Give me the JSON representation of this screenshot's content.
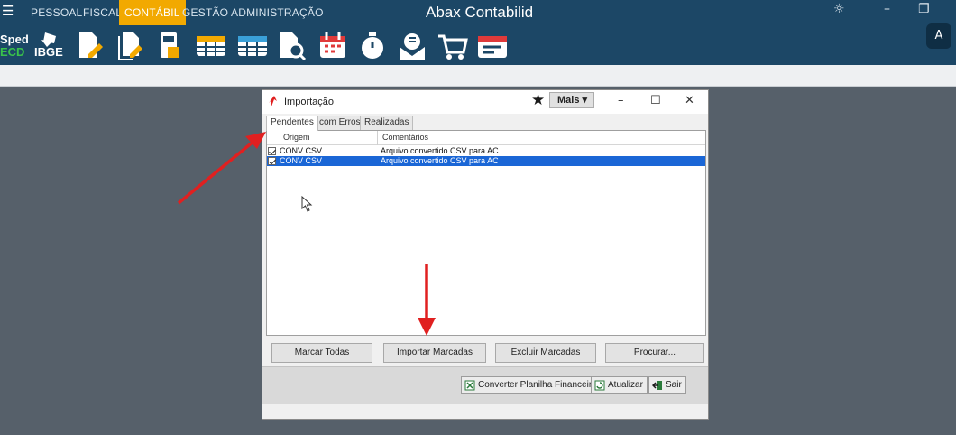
{
  "app": {
    "title": "Abax Contabilid",
    "menu": [
      "PESSOAL",
      "FISCAL",
      "CONTÁBIL",
      "GESTÃO",
      "ADMINISTRAÇÃO"
    ],
    "active_menu": "CONTÁBIL",
    "sped_line1": "Sped",
    "sped_line2": "ECD",
    "ibge_label": "IBGE",
    "translate_label": "A",
    "toolbar_icons": [
      "sped-ecd-icon",
      "ibge-icon",
      "document-edit-icon",
      "document-copy-edit-icon",
      "calculator-icon",
      "table-grid-icon",
      "table-grid-alt-icon",
      "document-search-icon",
      "calendar-icon",
      "stopwatch-icon",
      "mail-download-icon",
      "shopping-cart-icon",
      "card-icon"
    ]
  },
  "dialog": {
    "title": "Importação",
    "more_label": "Mais ▾",
    "tabs": [
      "Pendentes",
      "com Erros",
      "Realizadas"
    ],
    "active_tab": "Pendentes",
    "columns": [
      "Origem",
      "Comentários"
    ],
    "rows": [
      {
        "origem": "CONV CSV",
        "comentario": "Arquivo convertido CSV para AC",
        "checked": true,
        "selected": false
      },
      {
        "origem": "CONV CSV",
        "comentario": "Arquivo convertido CSV para AC",
        "checked": true,
        "selected": true
      }
    ],
    "buttons": {
      "marcar": "Marcar Todas",
      "importar": "Importar Marcadas",
      "excluir": "Excluir Marcadas",
      "procurar": "Procurar..."
    },
    "footer": {
      "converter": "Converter Planilha Financeira",
      "atualizar": "Atualizar",
      "sair": "Sair"
    }
  },
  "colors": {
    "appbar": "#1c4766",
    "active_menu": "#f2a900",
    "selection": "#1a66d6",
    "arrow": "#e02020"
  }
}
